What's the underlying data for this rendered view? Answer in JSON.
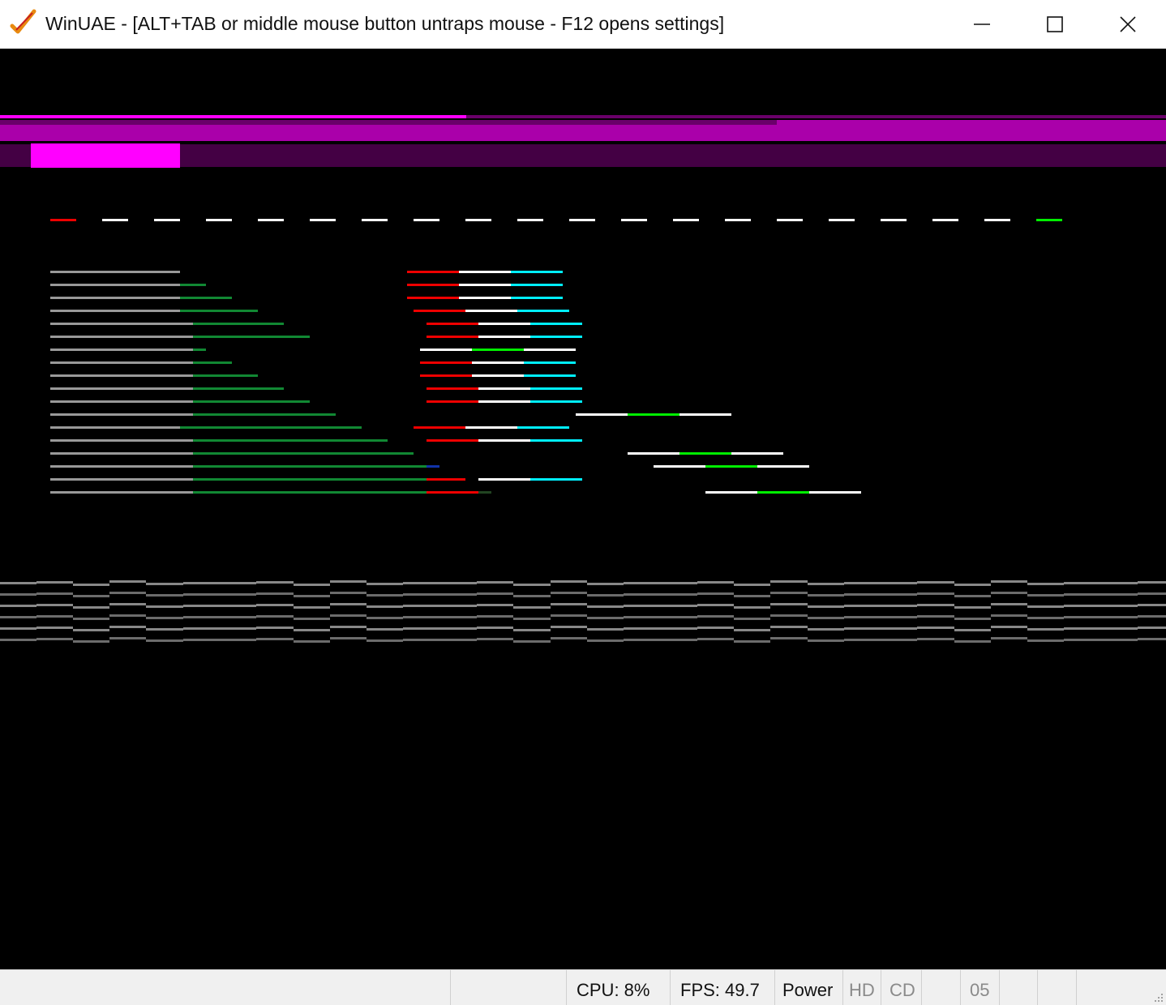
{
  "window": {
    "title": "WinUAE - [ALT+TAB or middle mouse button untraps mouse - F12 opens settings]",
    "icons": {
      "app": "winuae-checkmark-icon",
      "minimize": "minimize-icon",
      "maximize": "maximize-icon",
      "close": "close-icon"
    }
  },
  "statusbar": {
    "cpu": "CPU: 8%",
    "fps": "FPS: 49.7",
    "power": "Power",
    "hd": "HD",
    "cd": "CD",
    "track": "05"
  },
  "colors": {
    "screen_bg": "#000000",
    "magenta_bright": "#ff00ff",
    "magenta_mid": "#aa00aa",
    "magenta_dark": "#6a006a",
    "magenta_deep": "#440044",
    "red": "#ee0000",
    "white": "#ffffff",
    "cyan": "#00eeff",
    "green_bright": "#00ee00",
    "green_dark": "#118833",
    "gray": "#999999"
  }
}
